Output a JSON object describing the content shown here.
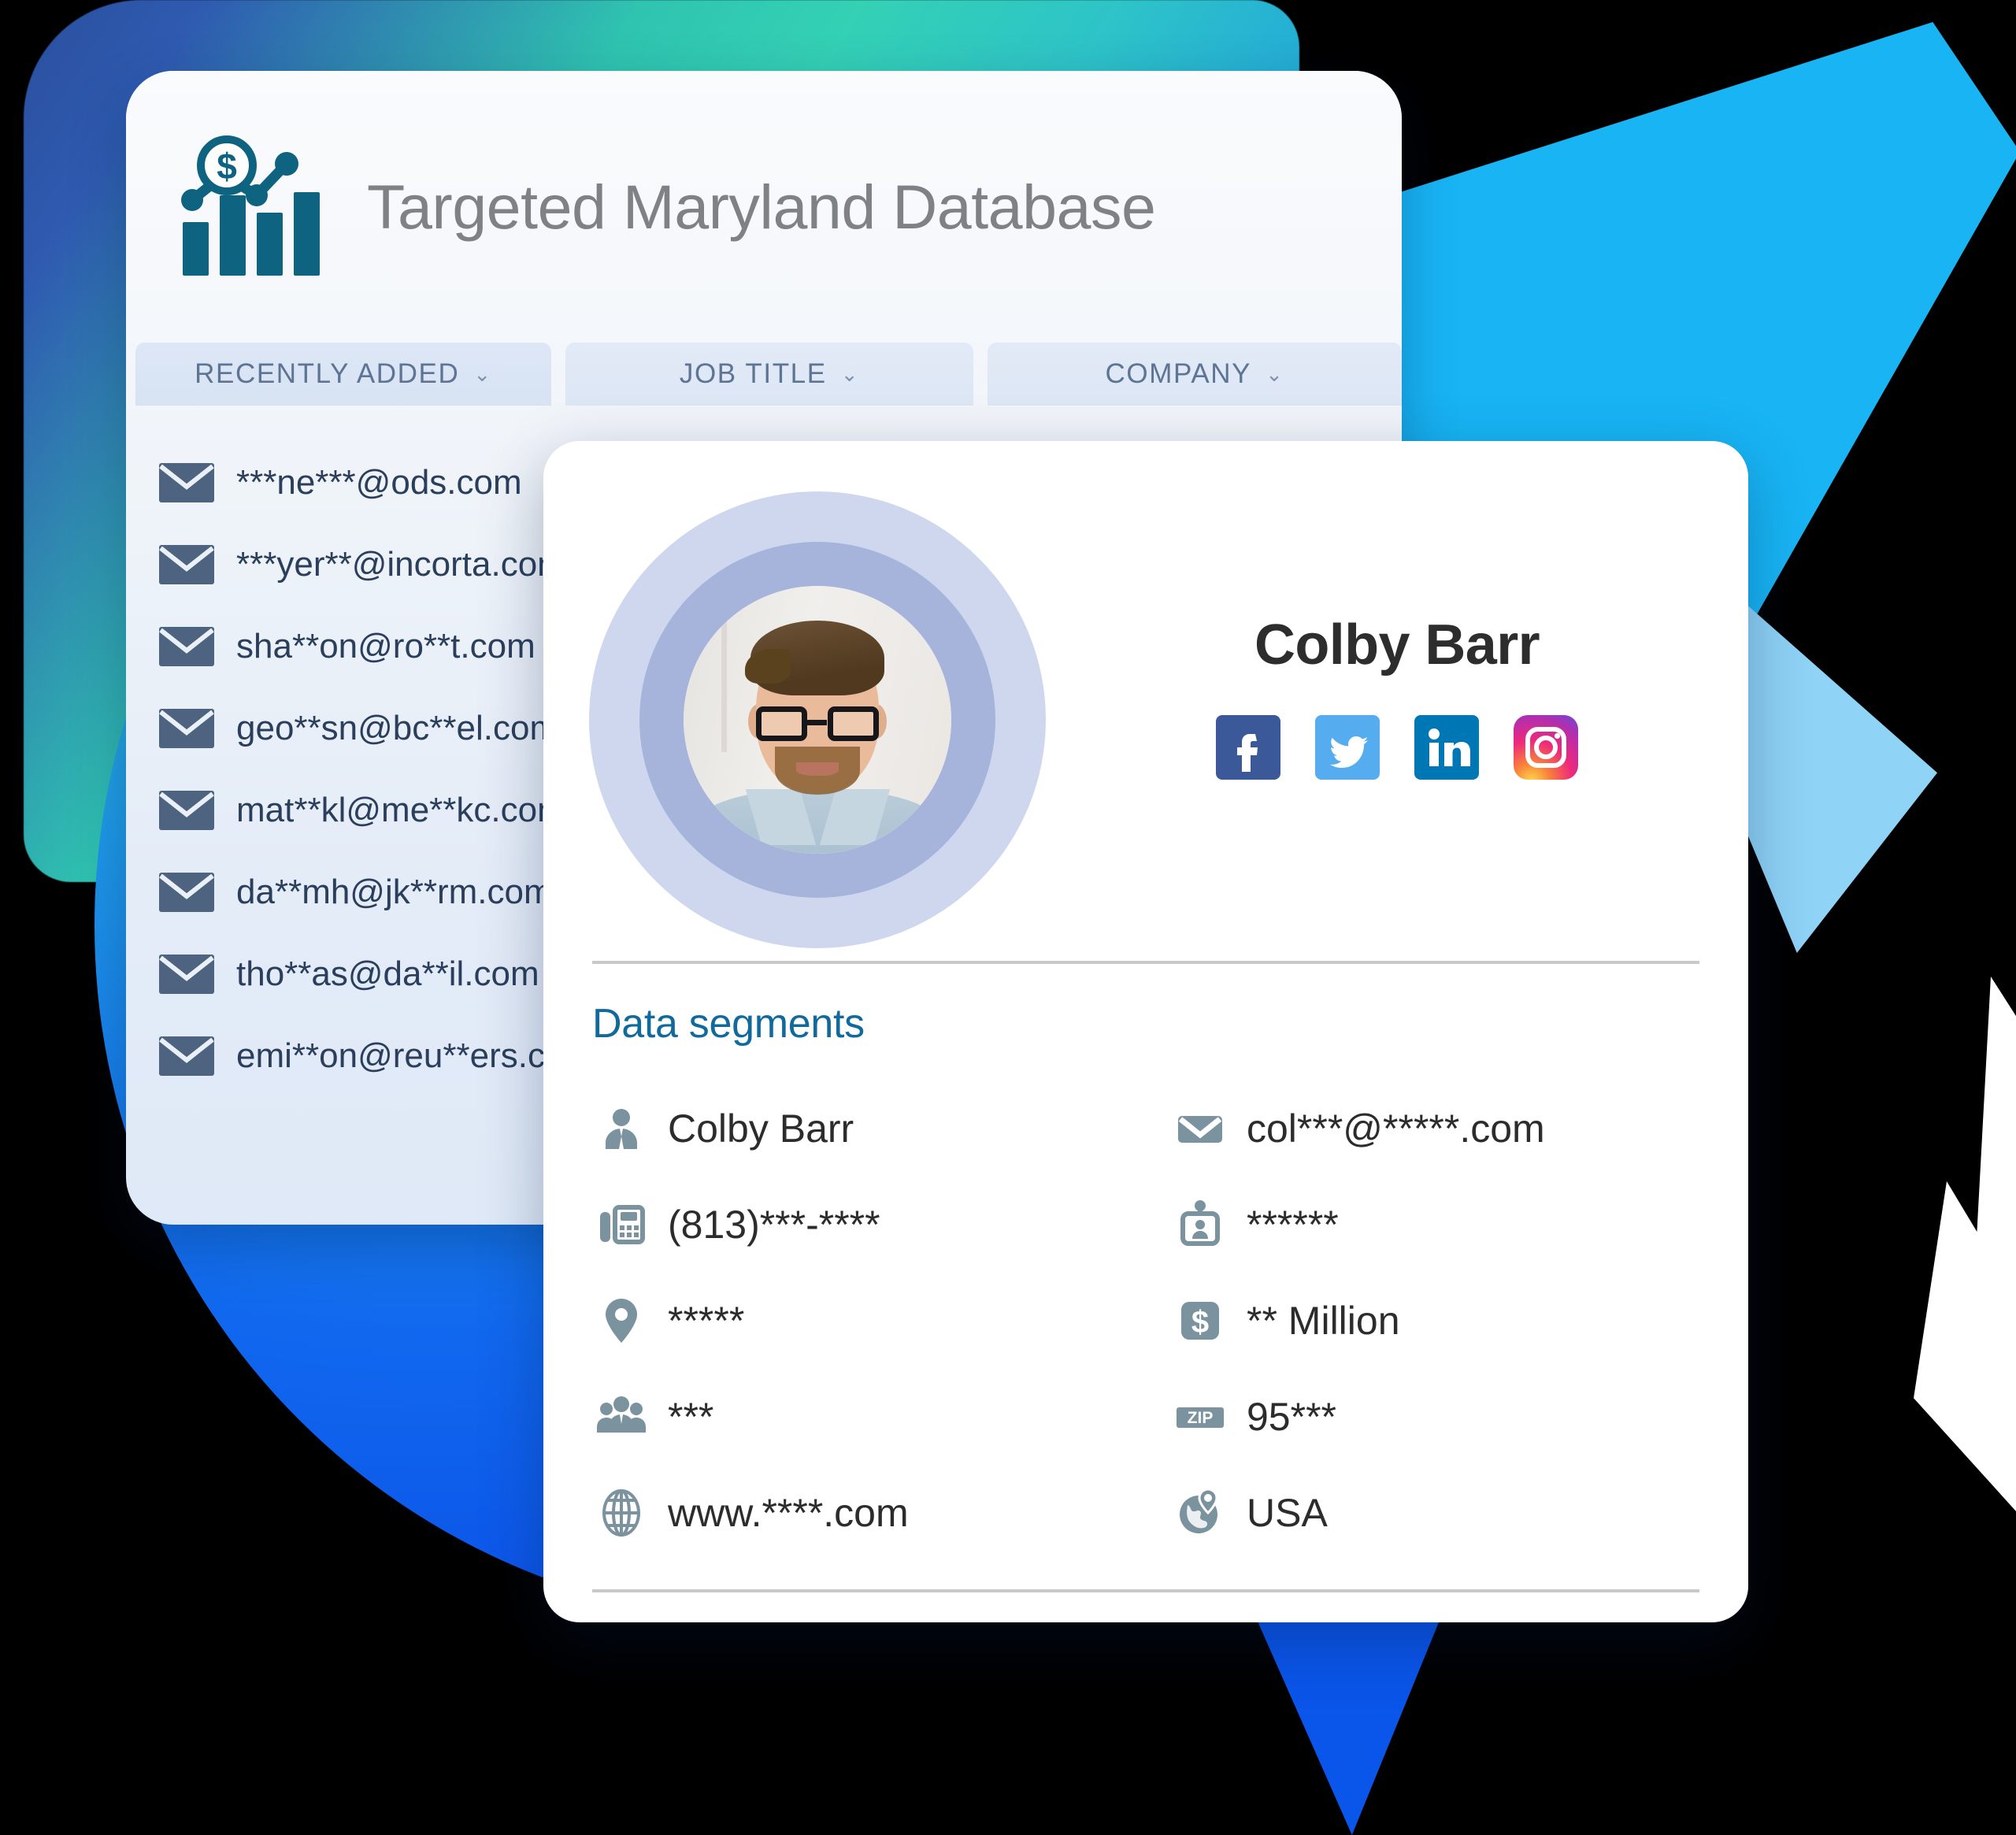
{
  "colors": {
    "brand_teal": "#2fc9b6",
    "brand_blue": "#0a55ea",
    "accent_cyan": "#18b4f4",
    "title_gray": "#7e8286",
    "segments_heading": "#126a9c",
    "icon_gray": "#78909c",
    "facebook": "#3b5998",
    "twitter": "#55acee",
    "linkedin": "#0077b5",
    "instagram_start": "#f9ce34",
    "instagram_mid": "#ee2a7b",
    "instagram_end": "#6228d7",
    "list_text": "#2b3f5c",
    "divider": "#c9c9c9"
  },
  "panel": {
    "logo_icon": "bar-chart-dollar-logo-icon",
    "title": "Targeted Maryland Database",
    "filters": [
      {
        "label": "RECENTLY ADDED",
        "chevron": "chevron-down-icon"
      },
      {
        "label": "JOB TITLE",
        "chevron": "chevron-down-icon"
      },
      {
        "label": "COMPANY",
        "chevron": "chevron-down-icon"
      }
    ],
    "emails": [
      {
        "icon": "envelope-icon",
        "address": "***ne***@ods.com"
      },
      {
        "icon": "envelope-icon",
        "address": "***yer**@incorta.com"
      },
      {
        "icon": "envelope-icon",
        "address": "sha**on@ro**t.com"
      },
      {
        "icon": "envelope-icon",
        "address": "geo**sn@bc**el.com"
      },
      {
        "icon": "envelope-icon",
        "address": "mat**kl@me**kc.com"
      },
      {
        "icon": "envelope-icon",
        "address": "da**mh@jk**rm.com"
      },
      {
        "icon": "envelope-icon",
        "address": "tho**as@da**il.com"
      },
      {
        "icon": "envelope-icon",
        "address": "emi**on@reu**ers.com"
      }
    ]
  },
  "contact_card": {
    "avatar": "profile-photo",
    "name": "Colby Barr",
    "socials": [
      {
        "name": "facebook-icon",
        "label": "f"
      },
      {
        "name": "twitter-icon",
        "label": ""
      },
      {
        "name": "linkedin-icon",
        "label": "in"
      },
      {
        "name": "instagram-icon",
        "label": ""
      }
    ],
    "segments_heading": "Data segments",
    "segments_left": [
      {
        "icon": "person-tie-icon",
        "value": "Colby Barr"
      },
      {
        "icon": "fax-phone-icon",
        "value": "(813)***-****"
      },
      {
        "icon": "map-pin-icon",
        "value": "*****"
      },
      {
        "icon": "people-group-icon",
        "value": "***"
      },
      {
        "icon": "globe-grid-icon",
        "value": "www.****.com"
      }
    ],
    "segments_right": [
      {
        "icon": "envelope-solid-icon",
        "value": "col***@*****.com"
      },
      {
        "icon": "id-badge-icon",
        "value": "******"
      },
      {
        "icon": "dollar-square-icon",
        "value": "** Million"
      },
      {
        "icon": "zip-badge-icon",
        "value": "95***"
      },
      {
        "icon": "globe-pin-icon",
        "value": "USA"
      }
    ]
  }
}
